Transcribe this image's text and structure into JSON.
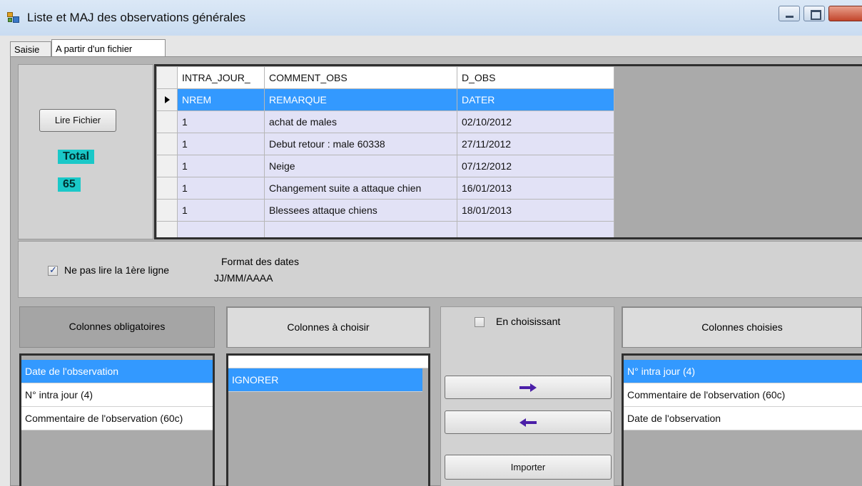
{
  "window": {
    "title": "Liste et MAJ des observations générales",
    "icon": "app-form-icon"
  },
  "tabs": [
    {
      "label": "Saisie",
      "active": false
    },
    {
      "label": "A partir d'un fichier",
      "active": true
    }
  ],
  "left_panel": {
    "read_button": "Lire Fichier",
    "total_label": "Total",
    "total_value": "65",
    "highlight_color": "#1ac8c8"
  },
  "grid": {
    "columns": [
      "INTRA_JOUR_",
      "COMMENT_OBS",
      "D_OBS"
    ],
    "rows": [
      [
        "NREM",
        "REMARQUE",
        "DATER"
      ],
      [
        "1",
        "achat de males",
        "02/10/2012"
      ],
      [
        "1",
        "Debut retour : male 60338",
        "27/11/2012"
      ],
      [
        "1",
        "Neige",
        "07/12/2012"
      ],
      [
        "1",
        "Changement suite a attaque chien",
        "16/01/2013"
      ],
      [
        "1",
        "Blessees attaque chiens",
        "18/01/2013"
      ]
    ],
    "selected_row": 0,
    "selection_color": "#3399ff"
  },
  "options": {
    "skip_first_line_label": "Ne pas lire la 1ère ligne",
    "skip_first_line_checked": true,
    "date_format_label": "Format des dates",
    "date_format_value": "JJ/MM/AAAA"
  },
  "mandatory": {
    "header": "Colonnes obligatoires",
    "items": [
      "Date de l'observation",
      "N° intra jour (4)",
      "Commentaire de l'observation (60c)"
    ],
    "selected": 0
  },
  "choose": {
    "header": "Colonnes à choisir",
    "items": [
      "IGNORER"
    ],
    "selected": 0
  },
  "actions": {
    "by_choosing_label": "En choisissant",
    "by_choosing_checked": false,
    "move_right_icon": "arrow-right-icon",
    "move_left_icon": "arrow-left-icon",
    "import_button": "Importer"
  },
  "chosen": {
    "header": "Colonnes choisies",
    "items": [
      "N° intra jour (4)",
      "Commentaire de l'observation (60c)",
      "Date de l'observation"
    ],
    "selected": 0
  }
}
